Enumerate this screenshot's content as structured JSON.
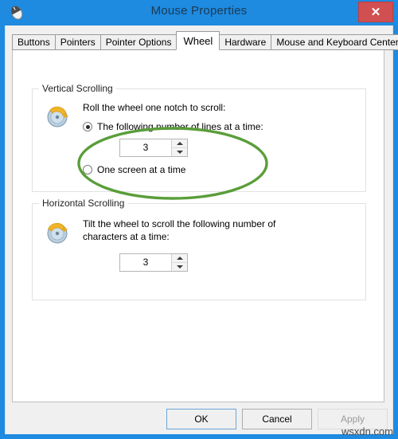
{
  "window": {
    "title": "Mouse Properties",
    "icon": "mouse-icon",
    "close_label": "✕",
    "frame_color": "#1e8ae0",
    "close_color": "#d05052"
  },
  "tabs": [
    {
      "label": "Buttons",
      "active": false
    },
    {
      "label": "Pointers",
      "active": false
    },
    {
      "label": "Pointer Options",
      "active": false
    },
    {
      "label": "Wheel",
      "active": true
    },
    {
      "label": "Hardware",
      "active": false
    },
    {
      "label": "Mouse and Keyboard Center",
      "active": false
    }
  ],
  "vertical_scrolling": {
    "title": "Vertical Scrolling",
    "icon": "mouse-wheel-vertical-icon",
    "description": "Roll the wheel one notch to scroll:",
    "options": [
      {
        "label": "The following number of lines at a time:",
        "selected": true
      },
      {
        "label": "One screen at a time",
        "selected": false
      }
    ],
    "spinner": {
      "value": "3"
    }
  },
  "horizontal_scrolling": {
    "title": "Horizontal Scrolling",
    "icon": "mouse-wheel-horizontal-icon",
    "description_line1": "Tilt the wheel to scroll the following number of",
    "description_line2": "characters at a time:",
    "spinner": {
      "value": "3"
    }
  },
  "annotation": {
    "shape": "ellipse-highlight",
    "color": "#5a9e3a"
  },
  "buttons": {
    "ok": "OK",
    "cancel": "Cancel",
    "apply": "Apply"
  },
  "watermark": "wsxdn.com"
}
